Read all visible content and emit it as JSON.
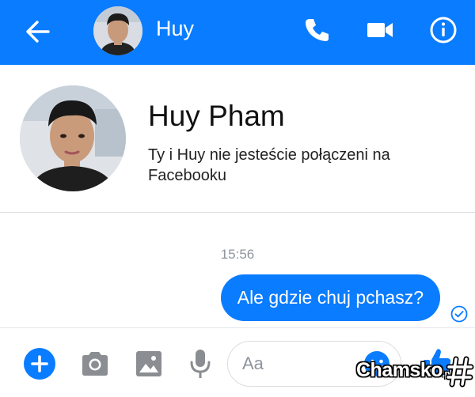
{
  "header": {
    "title": "Huy",
    "back_icon": "arrow-left-icon",
    "call_icon": "phone-icon",
    "video_icon": "video-camera-icon",
    "info_icon": "info-icon",
    "background_color": "#0a7cff"
  },
  "profile": {
    "name": "Huy Pham",
    "subtitle": "Ty i Huy nie jesteście połączeni na Facebooku"
  },
  "conversation": {
    "timestamp": "15:56",
    "messages": [
      {
        "sender": "me",
        "text": "Ale gdzie chuj pchasz?",
        "status_icon": "seen-check-icon"
      }
    ]
  },
  "composer": {
    "placeholder": "Aa",
    "value": "",
    "icons": [
      "plus-icon",
      "camera-icon",
      "image-icon",
      "microphone-icon",
      "emoji-icon",
      "thumbs-up-icon"
    ]
  },
  "watermark": {
    "text": "Chamsko",
    "suffix": ".pl"
  },
  "colors": {
    "accent": "#0a7cff",
    "timestamp": "#8d949e"
  }
}
